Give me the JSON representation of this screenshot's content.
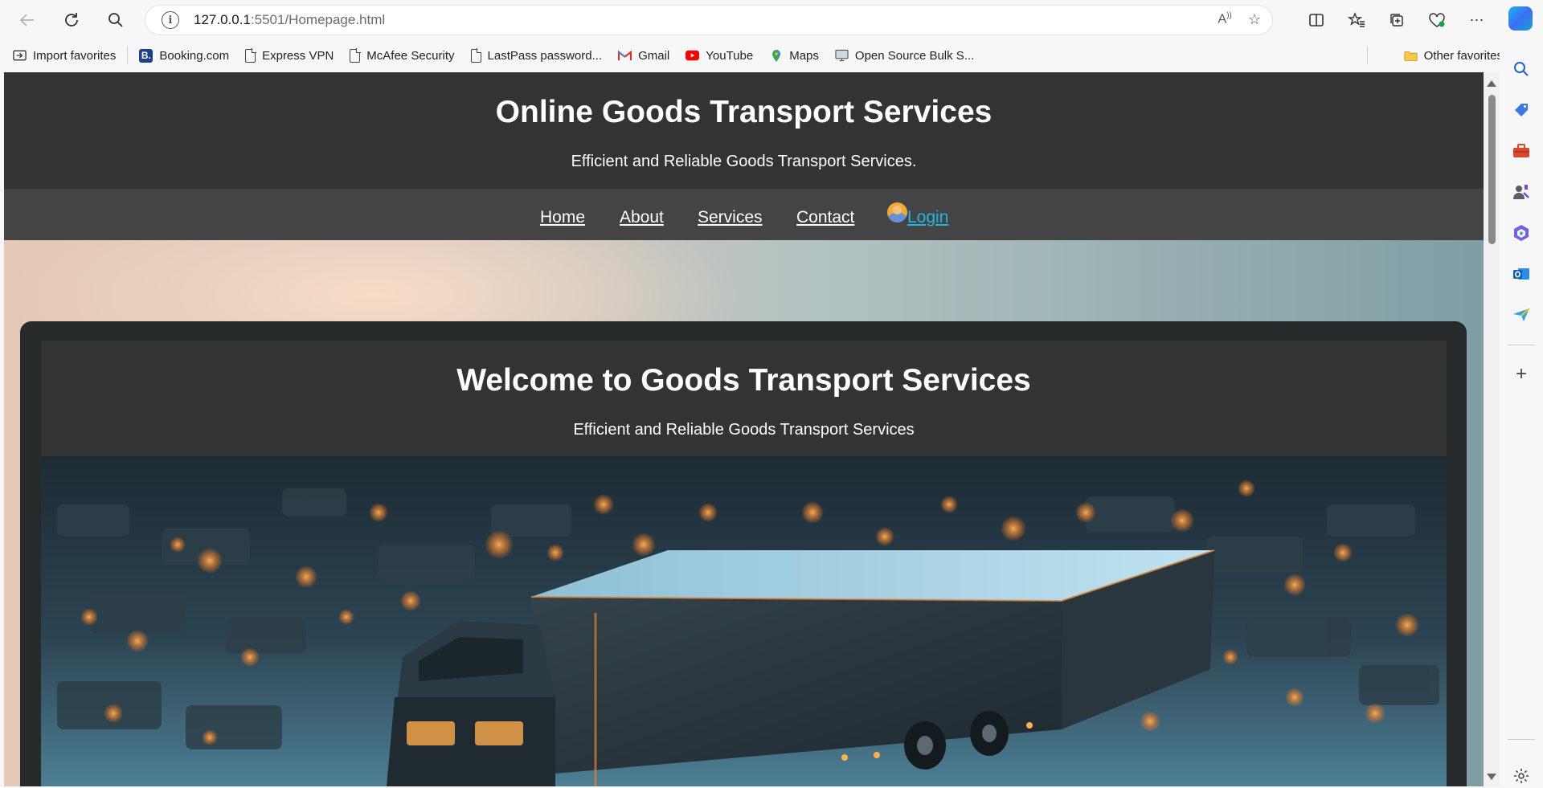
{
  "browser": {
    "url_host": "127.0.0.1",
    "url_rest": ":5501/Homepage.html",
    "favorites": [
      {
        "label": "Import favorites",
        "icon": "import-icon"
      },
      {
        "label": "Booking.com",
        "icon": "booking-icon"
      },
      {
        "label": "Express VPN",
        "icon": "page-icon"
      },
      {
        "label": "McAfee Security",
        "icon": "page-icon"
      },
      {
        "label": "LastPass password...",
        "icon": "page-icon"
      },
      {
        "label": "Gmail",
        "icon": "gmail-icon"
      },
      {
        "label": "YouTube",
        "icon": "youtube-icon"
      },
      {
        "label": "Maps",
        "icon": "maps-icon"
      },
      {
        "label": "Open Source Bulk S...",
        "icon": "monitor-icon"
      }
    ],
    "other_favorites": "Other favorites"
  },
  "site": {
    "title": "Online Goods Transport Services",
    "subtitle": "Efficient and Reliable Goods Transport Services.",
    "nav": {
      "home": "Home",
      "about": "About",
      "services": "Services",
      "contact": "Contact",
      "login": "Login"
    },
    "welcome": {
      "title": "Welcome to Goods Transport Services",
      "subtitle": "Efficient and Reliable Goods Transport Services"
    }
  },
  "colors": {
    "header_bg": "#333333",
    "nav_bg": "#444444",
    "login_link": "#1fb8e6"
  }
}
